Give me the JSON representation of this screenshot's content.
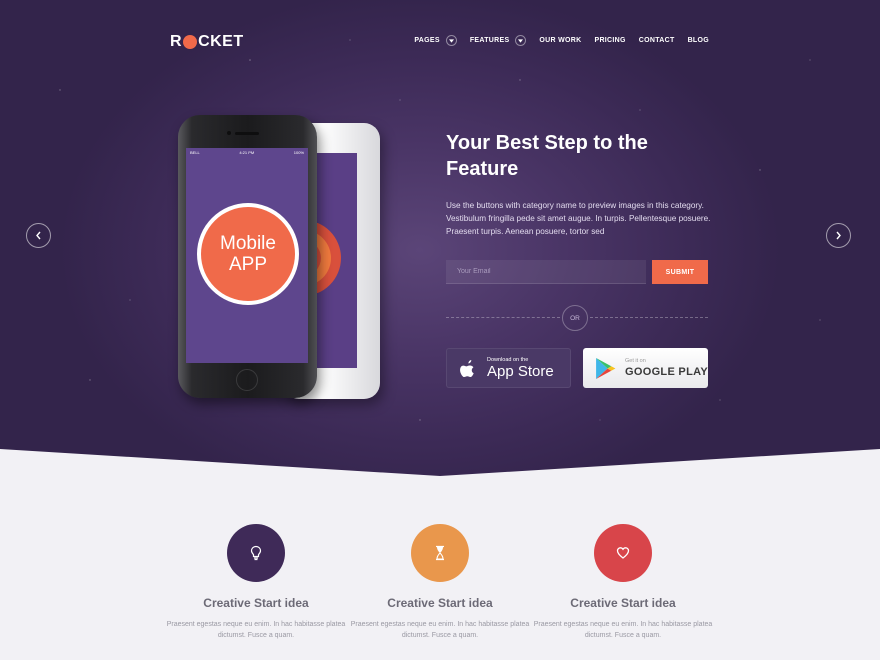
{
  "brand": {
    "logo_prefix": "R",
    "logo_suffix": "CKET"
  },
  "nav": {
    "items": [
      {
        "label": "PAGES",
        "dropdown": true
      },
      {
        "label": "FEATURES",
        "dropdown": true
      },
      {
        "label": "OUR WORK",
        "dropdown": false
      },
      {
        "label": "PRICING",
        "dropdown": false
      },
      {
        "label": "CONTACT",
        "dropdown": false
      },
      {
        "label": "BLOG",
        "dropdown": false
      }
    ]
  },
  "hero": {
    "headline": "Your Best Step to the Feature",
    "description": "Use the buttons with category name to preview images in this category. Vestibulum fringilla pede sit amet augue. In turpis. Pellentesque posuere. Praesent turpis. Aenean posuere, tortor sed",
    "email_placeholder": "Your Email",
    "submit_label": "SUBMIT",
    "or_label": "OR",
    "appstore": {
      "line1": "Download on the",
      "line2": "App Store"
    },
    "googleplay": {
      "line1": "Get it on",
      "line2": "GOOGLE PLAY"
    },
    "phone": {
      "carrier": "BELL",
      "time": "4:21 PM",
      "battery": "100%",
      "app_line1": "Mobile",
      "app_line2": "APP"
    }
  },
  "features": [
    {
      "icon": "lightbulb-icon",
      "color": "#3f2a58",
      "title": "Creative Start idea",
      "text": "Praesent egestas neque eu enim. In hac habitasse platea dictumst. Fusce a quam."
    },
    {
      "icon": "hourglass-icon",
      "color": "#e9974c",
      "title": "Creative Start idea",
      "text": "Praesent egestas neque eu enim. In hac habitasse platea dictumst. Fusce a quam."
    },
    {
      "icon": "heart-icon",
      "color": "#d8454a",
      "title": "Creative Start idea",
      "text": "Praesent egestas neque eu enim. In hac habitasse platea dictumst. Fusce a quam."
    }
  ],
  "colors": {
    "accent": "#f06a4a",
    "hero_bg": "#3c2a56",
    "page_bg": "#f2f1f5"
  }
}
